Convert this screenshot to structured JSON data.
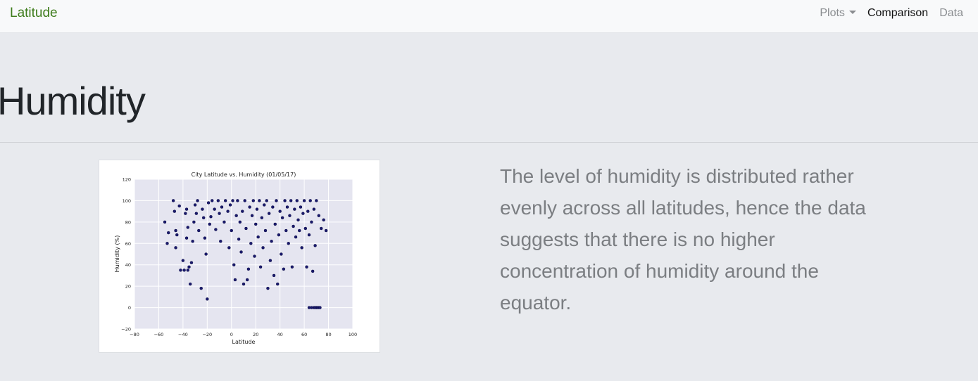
{
  "navbar": {
    "brand": "Latitude",
    "plots_label": "Plots",
    "comparison_label": "Comparison",
    "data_label": "Data"
  },
  "page": {
    "title": "Humidity",
    "description": "The level of humidity is distributed rather evenly across all latitudes, hence the data suggests that there is no higher concentration of humidity around the equator."
  },
  "colors": {
    "brand": "#3f7d1d",
    "plot_background": "#e5e5f0",
    "point": "#1a1a6e"
  },
  "chart_data": {
    "type": "scatter",
    "title": "City Latitude vs. Humidity (01/05/17)",
    "xlabel": "Latitude",
    "ylabel": "Humidity (%)",
    "xlim": [
      -80,
      100
    ],
    "ylim": [
      -20,
      120
    ],
    "xticks": [
      -80,
      -60,
      -40,
      -20,
      0,
      20,
      40,
      60,
      80,
      100
    ],
    "yticks": [
      -20,
      0,
      20,
      40,
      60,
      80,
      100,
      120
    ],
    "xtick_labels": [
      "−80",
      "−60",
      "−40",
      "−20",
      "0",
      "20",
      "40",
      "60",
      "80",
      "100"
    ],
    "ytick_labels": [
      "−20",
      "0",
      "20",
      "40",
      "60",
      "80",
      "100",
      "120"
    ],
    "grid": true,
    "points": [
      [
        -55,
        80
      ],
      [
        -53,
        60
      ],
      [
        -52,
        70
      ],
      [
        -48,
        100
      ],
      [
        -47,
        90
      ],
      [
        -46,
        72
      ],
      [
        -46,
        56
      ],
      [
        -45,
        68
      ],
      [
        -43,
        95
      ],
      [
        -42,
        35
      ],
      [
        -40,
        44
      ],
      [
        -39,
        35
      ],
      [
        -38,
        88
      ],
      [
        -37,
        92
      ],
      [
        -37,
        65
      ],
      [
        -36,
        75
      ],
      [
        -36,
        35
      ],
      [
        -35,
        38
      ],
      [
        -34,
        22
      ],
      [
        -33,
        42
      ],
      [
        -32,
        62
      ],
      [
        -31,
        80
      ],
      [
        -30,
        96
      ],
      [
        -29,
        88
      ],
      [
        -28,
        100
      ],
      [
        -27,
        72
      ],
      [
        -25,
        18
      ],
      [
        -24,
        92
      ],
      [
        -23,
        84
      ],
      [
        -22,
        65
      ],
      [
        -21,
        50
      ],
      [
        -20,
        8
      ],
      [
        -19,
        98
      ],
      [
        -18,
        78
      ],
      [
        -17,
        85
      ],
      [
        -16,
        100
      ],
      [
        -14,
        92
      ],
      [
        -13,
        73
      ],
      [
        -11,
        100
      ],
      [
        -10,
        88
      ],
      [
        -9,
        62
      ],
      [
        -8,
        94
      ],
      [
        -6,
        80
      ],
      [
        -5,
        100
      ],
      [
        -3,
        90
      ],
      [
        -2,
        56
      ],
      [
        -1,
        96
      ],
      [
        0,
        72
      ],
      [
        1,
        100
      ],
      [
        2,
        40
      ],
      [
        3,
        26
      ],
      [
        4,
        86
      ],
      [
        5,
        100
      ],
      [
        6,
        64
      ],
      [
        7,
        80
      ],
      [
        8,
        52
      ],
      [
        9,
        90
      ],
      [
        10,
        22
      ],
      [
        11,
        100
      ],
      [
        12,
        74
      ],
      [
        13,
        26
      ],
      [
        14,
        36
      ],
      [
        15,
        94
      ],
      [
        16,
        60
      ],
      [
        17,
        86
      ],
      [
        18,
        100
      ],
      [
        19,
        48
      ],
      [
        20,
        78
      ],
      [
        21,
        92
      ],
      [
        22,
        66
      ],
      [
        23,
        100
      ],
      [
        24,
        38
      ],
      [
        25,
        84
      ],
      [
        26,
        56
      ],
      [
        27,
        96
      ],
      [
        28,
        72
      ],
      [
        29,
        100
      ],
      [
        30,
        18
      ],
      [
        31,
        88
      ],
      [
        32,
        44
      ],
      [
        33,
        62
      ],
      [
        34,
        94
      ],
      [
        35,
        30
      ],
      [
        36,
        78
      ],
      [
        37,
        100
      ],
      [
        38,
        22
      ],
      [
        39,
        68
      ],
      [
        40,
        90
      ],
      [
        41,
        50
      ],
      [
        42,
        84
      ],
      [
        43,
        36
      ],
      [
        44,
        100
      ],
      [
        45,
        72
      ],
      [
        46,
        94
      ],
      [
        47,
        60
      ],
      [
        48,
        86
      ],
      [
        49,
        100
      ],
      [
        50,
        38
      ],
      [
        51,
        76
      ],
      [
        52,
        92
      ],
      [
        53,
        66
      ],
      [
        54,
        100
      ],
      [
        55,
        82
      ],
      [
        56,
        72
      ],
      [
        57,
        94
      ],
      [
        58,
        56
      ],
      [
        59,
        88
      ],
      [
        60,
        100
      ],
      [
        61,
        74
      ],
      [
        62,
        38
      ],
      [
        63,
        90
      ],
      [
        64,
        68
      ],
      [
        65,
        100
      ],
      [
        66,
        80
      ],
      [
        67,
        34
      ],
      [
        68,
        92
      ],
      [
        69,
        58
      ],
      [
        70,
        100
      ],
      [
        72,
        86
      ],
      [
        74,
        74
      ],
      [
        76,
        82
      ],
      [
        78,
        72
      ],
      [
        64,
        0
      ],
      [
        66,
        0
      ],
      [
        68,
        0
      ],
      [
        69,
        0
      ],
      [
        70,
        0
      ],
      [
        71,
        0
      ],
      [
        72,
        0
      ],
      [
        73,
        0
      ]
    ]
  }
}
